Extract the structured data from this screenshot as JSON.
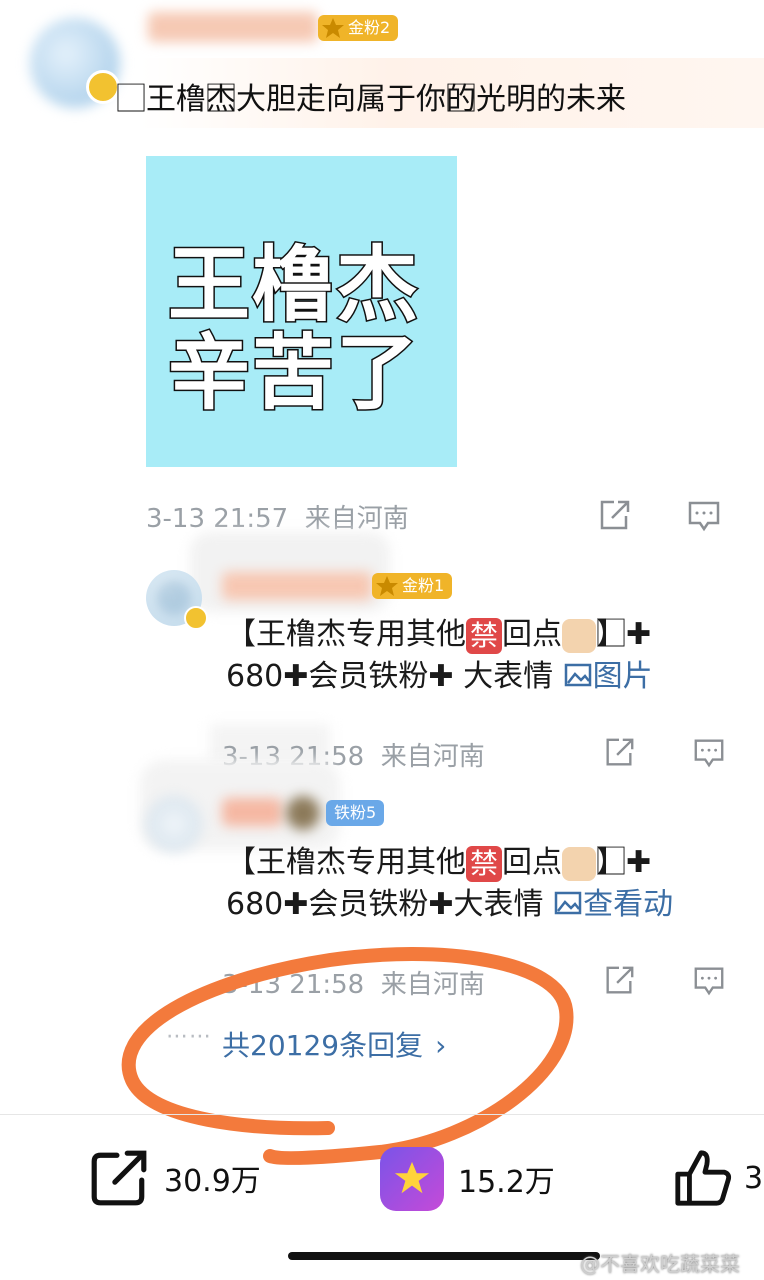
{
  "post": {
    "badge_label": "金粉2",
    "text": "⃞王橹杰⃞大胆走向属于你的⃞光明的未来",
    "image_line1": "王橹杰",
    "image_line2": "辛苦了",
    "meta": "3-13 21:57  来自河南"
  },
  "replies": [
    {
      "badge_label": "金粉1",
      "text_line1_a": "【王橹杰专用其他",
      "text_line1_b": "禁",
      "text_line1_c": "回点",
      "text_line1_d": "】⃞",
      "text_line2_a": "680",
      "text_line2_b": "会员铁粉",
      "text_line2_c": " 大表情 ",
      "link_icon": "image-icon",
      "link_text": "图片",
      "meta": "3-13 21:58  来自河南"
    },
    {
      "badge_label": "铁粉5",
      "text_line1_a": "【王橹杰专用其他",
      "text_line1_b": "禁",
      "text_line1_c": "回点",
      "text_line1_d": "】⃞",
      "text_line2_a": "680",
      "text_line2_b": "会员铁粉",
      "text_line2_c": "大表情 ",
      "link_text": "查看动",
      "meta": "3-13 21:58  来自河南"
    }
  ],
  "more_replies": "共20129条回复",
  "bottom_bar": {
    "share_count": "30.9万",
    "collect_count": "15.2万",
    "like_count": "3"
  },
  "watermark": "@不喜欢吃蔬菜菜",
  "colors": {
    "gold_badge": "#f0b429",
    "iron_badge": "#6aa8e8",
    "link": "#3c6ea5",
    "circle": "#f37a3c",
    "image_bg": "#a8ecf7"
  }
}
